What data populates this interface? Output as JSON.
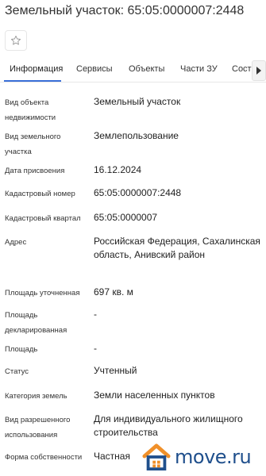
{
  "title": "Земельный участок: 65:05:0000007:2448",
  "tabs": [
    {
      "label": "Информация"
    },
    {
      "label": "Сервисы"
    },
    {
      "label": "Объекты"
    },
    {
      "label": "Части ЗУ"
    },
    {
      "label": "Соста"
    }
  ],
  "fields": [
    {
      "label": "Вид объекта недвижимости",
      "value": "Земельный участок"
    },
    {
      "label": "Вид земельного участка",
      "value": "Землепользование"
    },
    {
      "label": "Дата присвоения",
      "value": "16.12.2024"
    },
    {
      "label": "Кадастровый номер",
      "value": "65:05:0000007:2448"
    },
    {
      "label": "Кадастровый квартал",
      "value": "65:05:0000007"
    },
    {
      "label": "Адрес",
      "value": "Российская Федерация, Сахалинская область, Анивский район"
    },
    {
      "label": "Площадь уточненная",
      "value": "697 кв. м"
    },
    {
      "label": "Площадь декларированная",
      "value": "-"
    },
    {
      "label": "Площадь",
      "value": "-"
    },
    {
      "label": "Статус",
      "value": "Учтенный"
    },
    {
      "label": "Категория земель",
      "value": "Земли населенных пунктов"
    },
    {
      "label": "Вид разрешенного использования",
      "value": "Для индивидуального жилищного строительства"
    },
    {
      "label": "Форма собственности",
      "value": "Частная"
    }
  ],
  "watermark": {
    "text": "move.ru"
  },
  "icons": {
    "favorite": "star-outline-icon",
    "scroll_tabs": "chevron-right-icon",
    "logo": "house-logo-icon"
  },
  "colors": {
    "accent": "#3a6fd8",
    "logo_blue": "#1f4f8c",
    "logo_orange": "#f0902a"
  }
}
